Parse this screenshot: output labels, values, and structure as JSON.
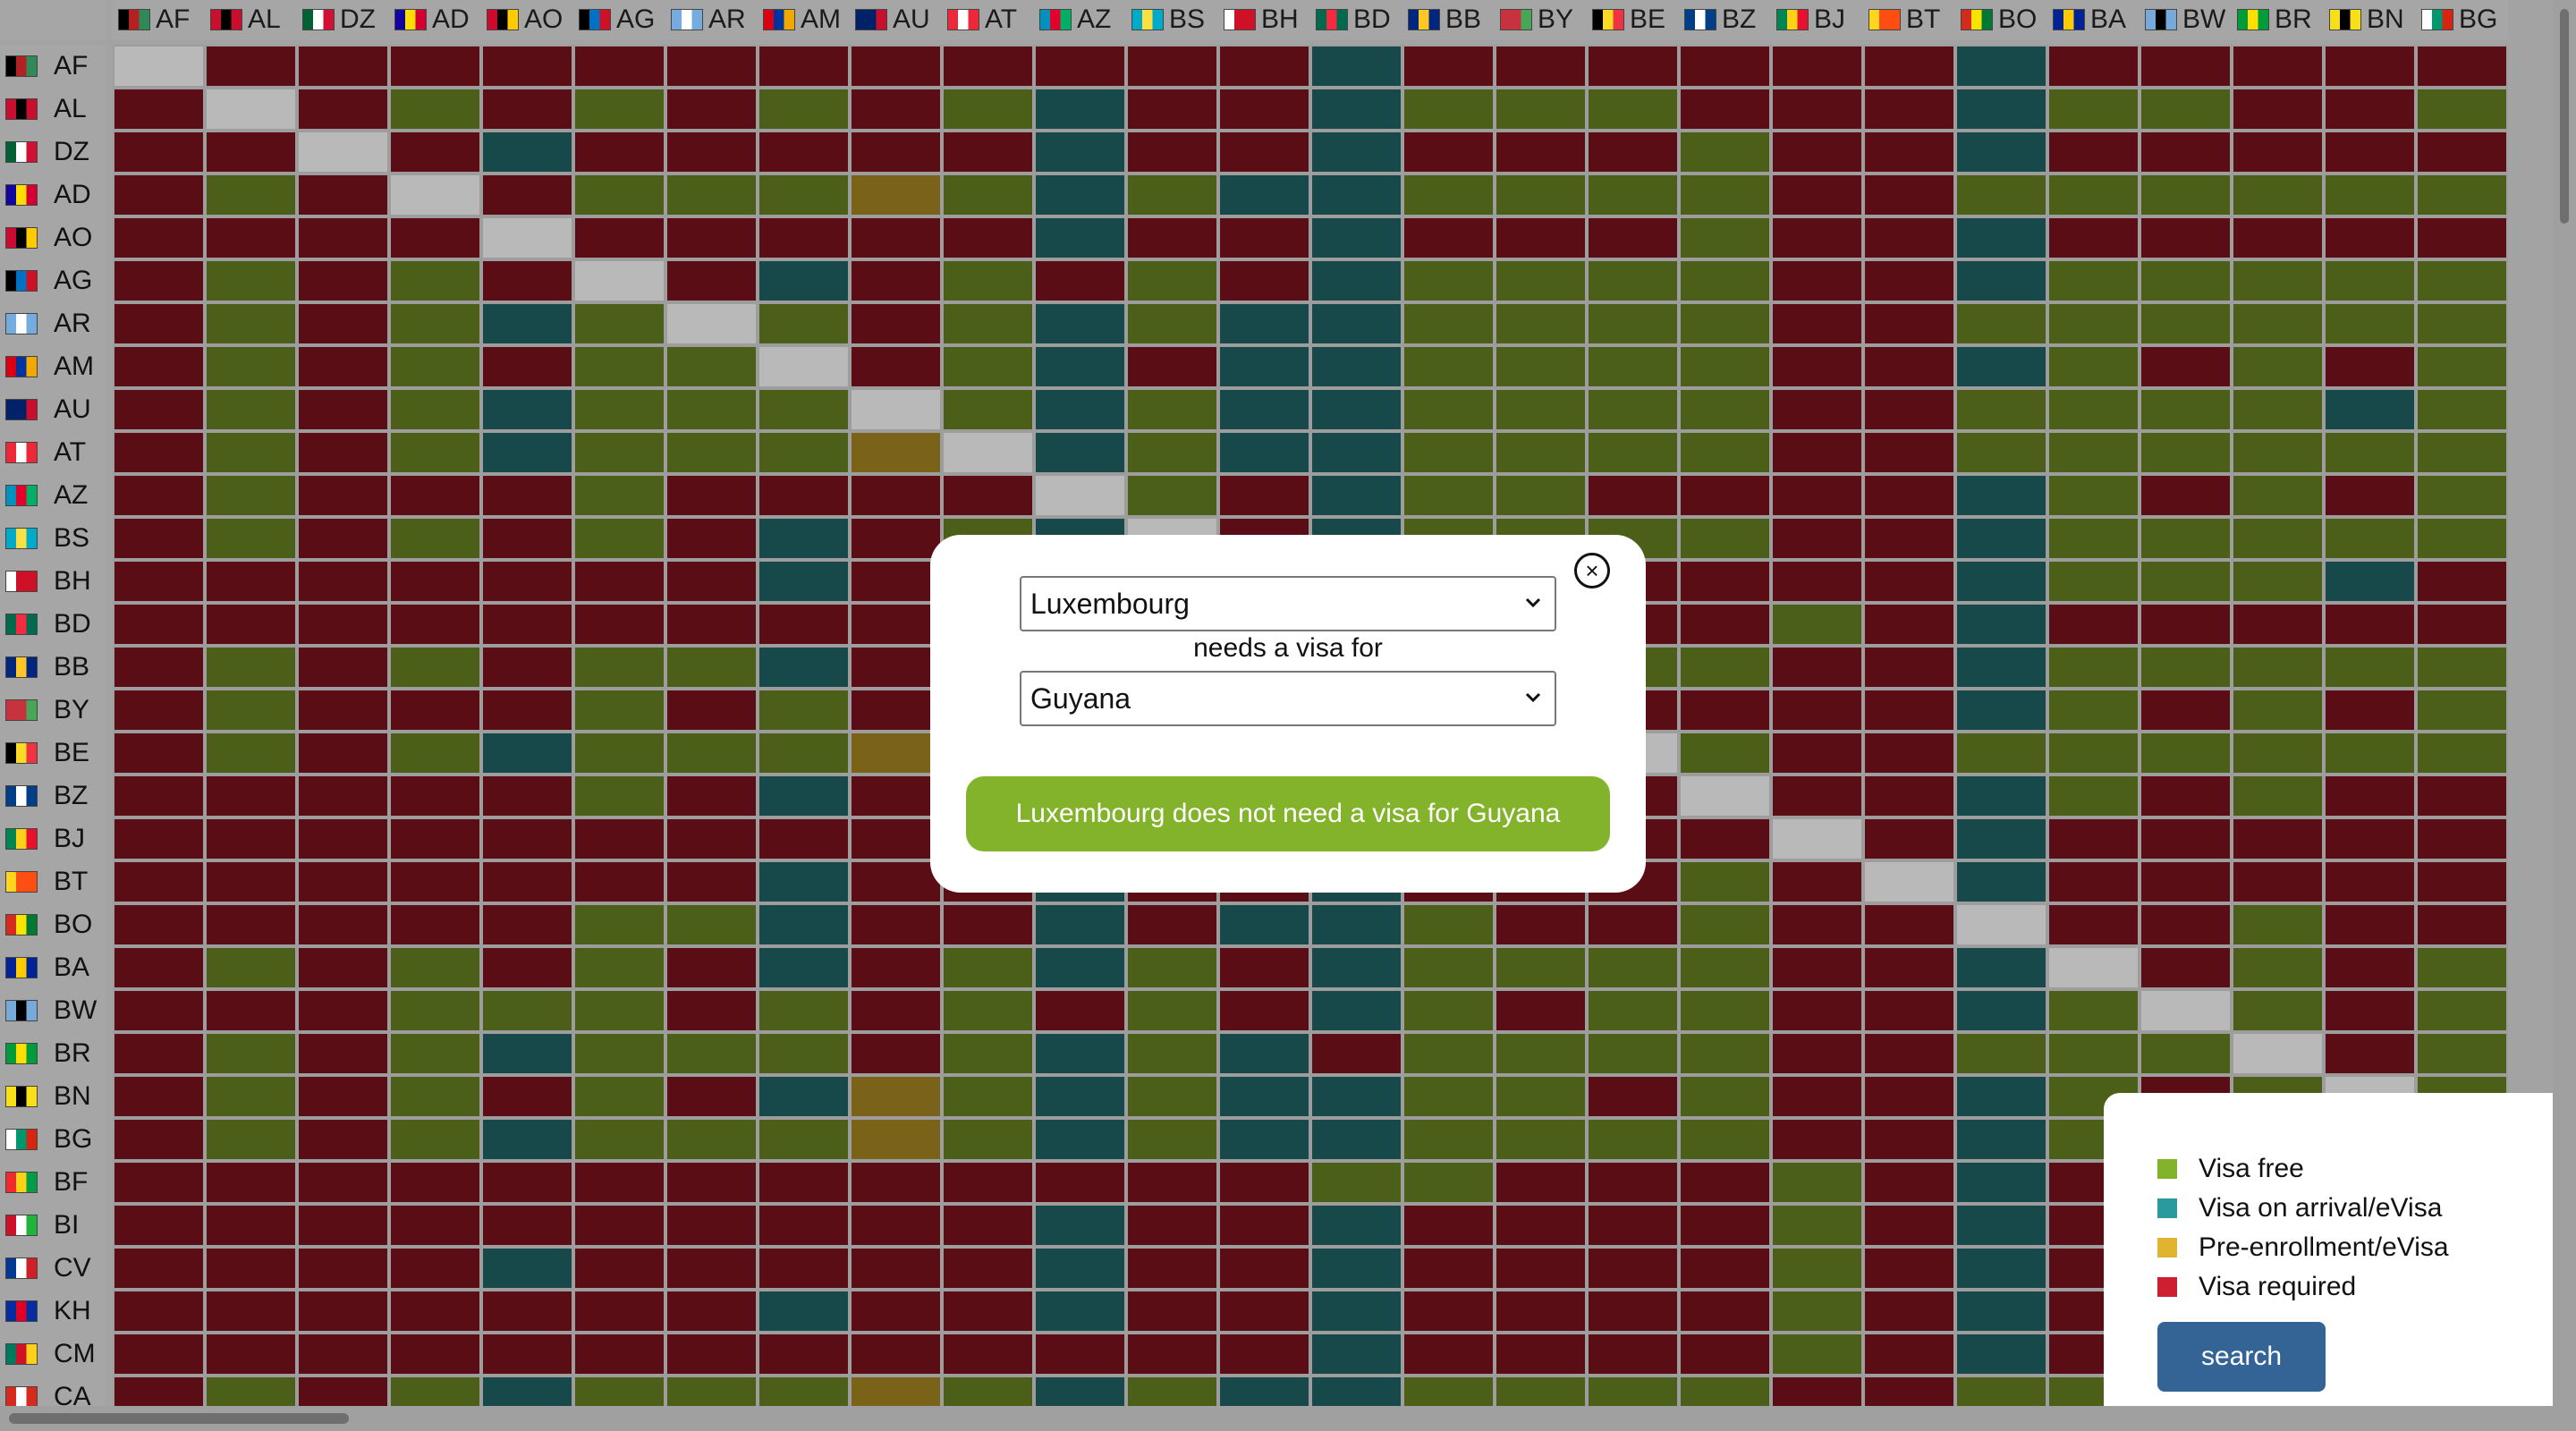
{
  "columns": [
    {
      "code": "AF",
      "flag": "flag-af-icon",
      "c1": "#000000",
      "c2": "#b22222",
      "c3": "#2e8b57"
    },
    {
      "code": "AL",
      "flag": "flag-al-icon",
      "c1": "#c8102e",
      "c2": "#000000",
      "c3": "#c8102e"
    },
    {
      "code": "DZ",
      "flag": "flag-dz-icon",
      "c1": "#006233",
      "c2": "#ffffff",
      "c3": "#d21034"
    },
    {
      "code": "AD",
      "flag": "flag-ad-icon",
      "c1": "#10069f",
      "c2": "#fedd00",
      "c3": "#d50032"
    },
    {
      "code": "AO",
      "flag": "flag-ao-icon",
      "c1": "#cc092f",
      "c2": "#000000",
      "c3": "#ffcb00"
    },
    {
      "code": "AG",
      "flag": "flag-ag-icon",
      "c1": "#000000",
      "c2": "#0072c6",
      "c3": "#ce1126"
    },
    {
      "code": "AR",
      "flag": "flag-ar-icon",
      "c1": "#74acdf",
      "c2": "#ffffff",
      "c3": "#74acdf"
    },
    {
      "code": "AM",
      "flag": "flag-am-icon",
      "c1": "#d90012",
      "c2": "#0033a0",
      "c3": "#f2a800"
    },
    {
      "code": "AU",
      "flag": "flag-au-icon",
      "c1": "#012169",
      "c2": "#012169",
      "c3": "#c8102e"
    },
    {
      "code": "AT",
      "flag": "flag-at-icon",
      "c1": "#ed2939",
      "c2": "#ffffff",
      "c3": "#ed2939"
    },
    {
      "code": "AZ",
      "flag": "flag-az-icon",
      "c1": "#0092bc",
      "c2": "#e4002b",
      "c3": "#00af66"
    },
    {
      "code": "BS",
      "flag": "flag-bs-icon",
      "c1": "#00abc9",
      "c2": "#fae042",
      "c3": "#00abc9"
    },
    {
      "code": "BH",
      "flag": "flag-bh-icon",
      "c1": "#ffffff",
      "c2": "#ce1126",
      "c3": "#ce1126"
    },
    {
      "code": "BD",
      "flag": "flag-bd-icon",
      "c1": "#006a4e",
      "c2": "#f42a41",
      "c3": "#006a4e"
    },
    {
      "code": "BB",
      "flag": "flag-bb-icon",
      "c1": "#00267f",
      "c2": "#ffc726",
      "c3": "#00267f"
    },
    {
      "code": "BY",
      "flag": "flag-by-icon",
      "c1": "#c8313e",
      "c2": "#c8313e",
      "c3": "#4aa657"
    },
    {
      "code": "BE",
      "flag": "flag-be-icon",
      "c1": "#000000",
      "c2": "#fdda24",
      "c3": "#ef3340"
    },
    {
      "code": "BZ",
      "flag": "flag-bz-icon",
      "c1": "#003f87",
      "c2": "#ffffff",
      "c3": "#003f87"
    },
    {
      "code": "BJ",
      "flag": "flag-bj-icon",
      "c1": "#008751",
      "c2": "#fcd116",
      "c3": "#e8112d"
    },
    {
      "code": "BT",
      "flag": "flag-bt-icon",
      "c1": "#ffd520",
      "c2": "#ff4e12",
      "c3": "#ff4e12"
    },
    {
      "code": "BO",
      "flag": "flag-bo-icon",
      "c1": "#d52b1e",
      "c2": "#f9e300",
      "c3": "#007934"
    },
    {
      "code": "BA",
      "flag": "flag-ba-icon",
      "c1": "#002395",
      "c2": "#fecb00",
      "c3": "#002395"
    },
    {
      "code": "BW",
      "flag": "flag-bw-icon",
      "c1": "#75aadb",
      "c2": "#000000",
      "c3": "#75aadb"
    },
    {
      "code": "BR",
      "flag": "flag-br-icon",
      "c1": "#009c3b",
      "c2": "#ffdf00",
      "c3": "#009c3b"
    },
    {
      "code": "BN",
      "flag": "flag-bn-icon",
      "c1": "#f7e017",
      "c2": "#000000",
      "c3": "#f7e017"
    },
    {
      "code": "BG",
      "flag": "flag-bg-icon",
      "c1": "#ffffff",
      "c2": "#00966e",
      "c3": "#d62612"
    }
  ],
  "rows": [
    {
      "code": "AF",
      "flag": "flag-af-icon",
      "c1": "#000000",
      "c2": "#b22222",
      "c3": "#2e8b57",
      "cells": "xRRRRRRRRRRRRARRRRRRARRRRR"
    },
    {
      "code": "AL",
      "flag": "flag-al-icon",
      "c1": "#c8102e",
      "c2": "#000000",
      "c3": "#c8102e",
      "cells": "RxRFRFRFRFARRAFFFRRRAFFRRF"
    },
    {
      "code": "DZ",
      "flag": "flag-dz-icon",
      "c1": "#006233",
      "c2": "#ffffff",
      "c3": "#d21034",
      "cells": "RRxRARRRRRARRARRRFRRARRRRR"
    },
    {
      "code": "AD",
      "flag": "flag-ad-icon",
      "c1": "#10069f",
      "c2": "#fedd00",
      "c3": "#d50032",
      "cells": "RFRxRFFFPFAFAAFFFFRRFFFFFF"
    },
    {
      "code": "AO",
      "flag": "flag-ao-icon",
      "c1": "#cc092f",
      "c2": "#000000",
      "c3": "#ffcb00",
      "cells": "RRRRxRRRRRARRARRRFRRARRRRR"
    },
    {
      "code": "AG",
      "flag": "flag-ag-icon",
      "c1": "#000000",
      "c2": "#0072c6",
      "c3": "#ce1126",
      "cells": "RFRFRxRARFRFRAFFFFRRAFFFFF"
    },
    {
      "code": "AR",
      "flag": "flag-ar-icon",
      "c1": "#74acdf",
      "c2": "#ffffff",
      "c3": "#74acdf",
      "cells": "RFRFAFxFRFAFAAFFFFRRFFFFFF"
    },
    {
      "code": "AM",
      "flag": "flag-am-icon",
      "c1": "#d90012",
      "c2": "#0033a0",
      "c3": "#f2a800",
      "cells": "RFRFRFFxRFARAAFFFFRRAFRFRF"
    },
    {
      "code": "AU",
      "flag": "flag-au-icon",
      "c1": "#012169",
      "c2": "#012169",
      "c3": "#c8102e",
      "cells": "RFRFAFFFxFAFAAFFFFRRFFFFAF"
    },
    {
      "code": "AT",
      "flag": "flag-at-icon",
      "c1": "#ed2939",
      "c2": "#ffffff",
      "c3": "#ed2939",
      "cells": "RFRFAFFFPxAFAAFFFFRRFFFFFF"
    },
    {
      "code": "AZ",
      "flag": "flag-az-icon",
      "c1": "#0092bc",
      "c2": "#e4002b",
      "c3": "#00af66",
      "cells": "RFRRRFRRRRxFRAFFRRRRAFRFRF"
    },
    {
      "code": "BS",
      "flag": "flag-bs-icon",
      "c1": "#00abc9",
      "c2": "#fae042",
      "c3": "#00abc9",
      "cells": "RFRFRFRARFAxRAFFFFRRAFFFFF"
    },
    {
      "code": "BH",
      "flag": "flag-bh-icon",
      "c1": "#ffffff",
      "c2": "#ce1126",
      "c3": "#ce1126",
      "cells": "RRRRRRRARRARxARRRRRRAFFFAR"
    },
    {
      "code": "BD",
      "flag": "flag-bd-icon",
      "c1": "#006a4e",
      "c2": "#f42a41",
      "c3": "#006a4e",
      "cells": "RRRRRRRRRRARRxRRRRFRARRRRR"
    },
    {
      "code": "BB",
      "flag": "flag-bb-icon",
      "c1": "#00267f",
      "c2": "#ffc726",
      "c3": "#00267f",
      "cells": "RFRFRFFARFAFRAxFFFRRAFFFFF"
    },
    {
      "code": "BY",
      "flag": "flag-by-icon",
      "c1": "#c8313e",
      "c2": "#c8313e",
      "c3": "#4aa657",
      "cells": "RFRRRFRFRRAFRARxRRRRAFRFRF"
    },
    {
      "code": "BE",
      "flag": "flag-be-icon",
      "c1": "#000000",
      "c2": "#fdda24",
      "c3": "#ef3340",
      "cells": "RFRFAFFFPFAFAAFFxFRRFFFFFF"
    },
    {
      "code": "BZ",
      "flag": "flag-bz-icon",
      "c1": "#003f87",
      "c2": "#ffffff",
      "c3": "#003f87",
      "cells": "RRRRRFRARRARRAFRRxRRAFRFRR"
    },
    {
      "code": "BJ",
      "flag": "flag-bj-icon",
      "c1": "#008751",
      "c2": "#fcd116",
      "c3": "#e8112d",
      "cells": "RRRRRRRRRRARRARRRRxRARRRRR"
    },
    {
      "code": "BT",
      "flag": "flag-bt-icon",
      "c1": "#ffd520",
      "c2": "#ff4e12",
      "c3": "#ff4e12",
      "cells": "RRRRRRRARRARRARRRFRxARRRRR"
    },
    {
      "code": "BO",
      "flag": "flag-bo-icon",
      "c1": "#d52b1e",
      "c2": "#f9e300",
      "c3": "#007934",
      "cells": "RRRRRFFARRARAAFRRFRRxRRFRR"
    },
    {
      "code": "BA",
      "flag": "flag-ba-icon",
      "c1": "#002395",
      "c2": "#fecb00",
      "c3": "#002395",
      "cells": "RFRFRFRARFAFRAFFFFRRAxRFRF"
    },
    {
      "code": "BW",
      "flag": "flag-bw-icon",
      "c1": "#75aadb",
      "c2": "#000000",
      "c3": "#75aadb",
      "cells": "RRRFFFRFRFRFRAFRFFRRAFxFRF"
    },
    {
      "code": "BR",
      "flag": "flag-br-icon",
      "c1": "#009c3b",
      "c2": "#ffdf00",
      "c3": "#009c3b",
      "cells": "RFRFAFFFRFAFARFFFFRRFFFxRF"
    },
    {
      "code": "BN",
      "flag": "flag-bn-icon",
      "c1": "#f7e017",
      "c2": "#000000",
      "c3": "#f7e017",
      "cells": "RFRFRFRAPFAFAAFFRFRRAFRFxF"
    },
    {
      "code": "BG",
      "flag": "flag-bg-icon",
      "c1": "#ffffff",
      "c2": "#00966e",
      "c3": "#d62612",
      "cells": "RFRFAFFFPFAFAAFFFFRRAFFFFx"
    },
    {
      "code": "BF",
      "flag": "flag-bf-icon",
      "c1": "#ef2b2d",
      "c2": "#fcd116",
      "c3": "#009e49",
      "cells": "RRRRRRRRRRRRRFFRRRFRARRRRR"
    },
    {
      "code": "BI",
      "flag": "flag-bi-icon",
      "c1": "#ce1126",
      "c2": "#ffffff",
      "c3": "#1eb53a",
      "cells": "RRRRRRRRRRARRARRRRFRARRRRR"
    },
    {
      "code": "CV",
      "flag": "flag-cv-icon",
      "c1": "#003893",
      "c2": "#ffffff",
      "c3": "#cf2027",
      "cells": "RRRRARRRRRARRARRRRFRARRRRR"
    },
    {
      "code": "KH",
      "flag": "flag-kh-icon",
      "c1": "#032ea1",
      "c2": "#e00025",
      "c3": "#032ea1",
      "cells": "RRRRRRRARRARRARRRRFRARRRRR"
    },
    {
      "code": "CM",
      "flag": "flag-cm-icon",
      "c1": "#007a5e",
      "c2": "#ce1126",
      "c3": "#fcd116",
      "cells": "RRRRRRRRRRRRRARRRRFRARRRRR"
    },
    {
      "code": "CA",
      "flag": "flag-ca-icon",
      "c1": "#d52b1e",
      "c2": "#ffffff",
      "c3": "#d52b1e",
      "cells": "RFRFAFFFPFAFAAFFFFRRFFFFFF"
    }
  ],
  "modal": {
    "from_country": "Luxembourg",
    "needs_text": "needs a visa for",
    "to_country": "Guyana",
    "result_text": "Luxembourg does not need a visa for Guyana",
    "close_icon": "close-circle-icon"
  },
  "legend": {
    "items": [
      {
        "label": "Visa free",
        "color": "#83b22b"
      },
      {
        "label": "Visa on arrival/eVisa",
        "color": "#2a9a9f"
      },
      {
        "label": "Pre-enrollment/eVisa",
        "color": "#e0b331"
      },
      {
        "label": "Visa required",
        "color": "#cc1f2f"
      }
    ],
    "search_label": "search"
  }
}
